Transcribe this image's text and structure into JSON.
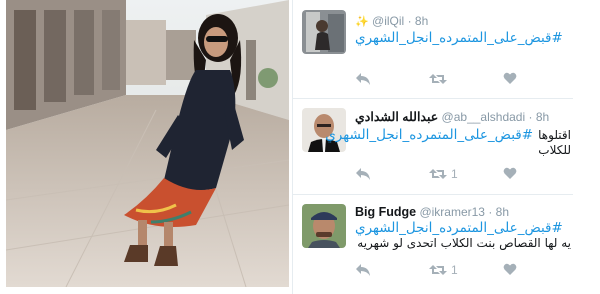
{
  "tweets": [
    {
      "name": "",
      "handle": "@ilQil",
      "time": "8h",
      "hashtag": "#قبض_على_المتمرده_انجل_الشهري",
      "text": "",
      "retweets": "",
      "avatar_icon": "person-in-doorway-avatar",
      "handle_icon": "sparkle-icon"
    },
    {
      "name": "عبدالله الشدادي",
      "handle": "@ab__alshdadi",
      "time": "8h",
      "hashtag": "#قبض_على_المتمرده_انجل_الشهري",
      "text_line1": "اقتلوها",
      "text_line2": "للكلاب",
      "retweets": "1",
      "avatar_icon": "bald-man-avatar"
    },
    {
      "name": "Big Fudge",
      "handle": "@ikramer13",
      "time": "8h",
      "hashtag": "#قبض_على_المتمرده_انجل_الشهري",
      "text_line1": "يه لها القصاص بنت الكلاب اتحدى لو شهريه",
      "retweets": "1",
      "avatar_icon": "man-in-cap-avatar"
    }
  ],
  "actions": {
    "reply_icon": "reply-icon",
    "retweet_icon": "retweet-icon",
    "like_icon": "heart-icon"
  },
  "colors": {
    "link": "#1b95e0",
    "muted": "#8899a6",
    "icon": "#a5b0b8"
  }
}
